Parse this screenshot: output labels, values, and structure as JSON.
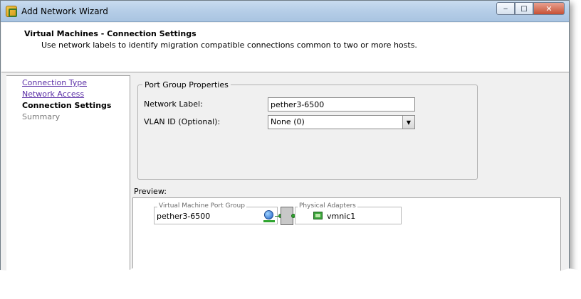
{
  "window": {
    "title": "Add Network Wizard",
    "minimize_glyph": "‒",
    "maximize_glyph": "□",
    "close_glyph": "✕"
  },
  "header": {
    "title": "Virtual Machines - Connection Settings",
    "subtitle": "Use network labels to identify migration compatible connections common to two or more hosts."
  },
  "nav": {
    "items": [
      {
        "label": "Connection Type",
        "state": "visited"
      },
      {
        "label": "Network Access",
        "state": "visited"
      },
      {
        "label": "Connection Settings",
        "state": "current"
      },
      {
        "label": "Summary",
        "state": "upcoming"
      }
    ]
  },
  "port_group": {
    "legend": "Port Group Properties",
    "network_label_label": "Network Label:",
    "network_label_value": "pether3-6500",
    "vlan_label": "VLAN ID (Optional):",
    "vlan_value": "None (0)"
  },
  "preview": {
    "label": "Preview:",
    "vm_port_group_legend": "Virtual Machine Port Group",
    "vm_port_group_name": "pether3-6500",
    "physical_adapters_legend": "Physical Adapters",
    "adapter_name": "vmnic1"
  },
  "icons": {
    "app": "network-wizard-icon",
    "port_group": "globe-network-icon",
    "adapter": "nic-card-icon",
    "dropdown": "chevron-down-icon"
  },
  "colors": {
    "visited_link": "#5a2ea6",
    "connector_green": "#2fa42f",
    "close_red": "#c75034"
  }
}
